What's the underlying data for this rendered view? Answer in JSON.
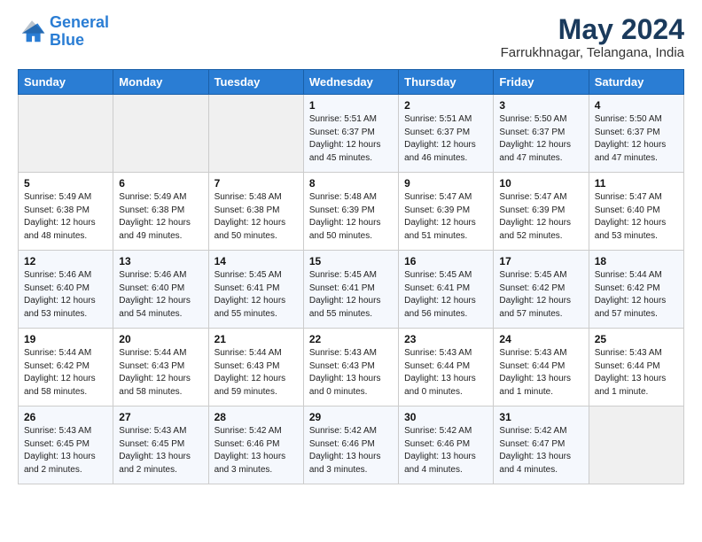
{
  "logo": {
    "line1": "General",
    "line2": "Blue"
  },
  "title": "May 2024",
  "subtitle": "Farrukhnagar, Telangana, India",
  "days_of_week": [
    "Sunday",
    "Monday",
    "Tuesday",
    "Wednesday",
    "Thursday",
    "Friday",
    "Saturday"
  ],
  "weeks": [
    [
      {
        "day": "",
        "info": ""
      },
      {
        "day": "",
        "info": ""
      },
      {
        "day": "",
        "info": ""
      },
      {
        "day": "1",
        "info": "Sunrise: 5:51 AM\nSunset: 6:37 PM\nDaylight: 12 hours\nand 45 minutes."
      },
      {
        "day": "2",
        "info": "Sunrise: 5:51 AM\nSunset: 6:37 PM\nDaylight: 12 hours\nand 46 minutes."
      },
      {
        "day": "3",
        "info": "Sunrise: 5:50 AM\nSunset: 6:37 PM\nDaylight: 12 hours\nand 47 minutes."
      },
      {
        "day": "4",
        "info": "Sunrise: 5:50 AM\nSunset: 6:37 PM\nDaylight: 12 hours\nand 47 minutes."
      }
    ],
    [
      {
        "day": "5",
        "info": "Sunrise: 5:49 AM\nSunset: 6:38 PM\nDaylight: 12 hours\nand 48 minutes."
      },
      {
        "day": "6",
        "info": "Sunrise: 5:49 AM\nSunset: 6:38 PM\nDaylight: 12 hours\nand 49 minutes."
      },
      {
        "day": "7",
        "info": "Sunrise: 5:48 AM\nSunset: 6:38 PM\nDaylight: 12 hours\nand 50 minutes."
      },
      {
        "day": "8",
        "info": "Sunrise: 5:48 AM\nSunset: 6:39 PM\nDaylight: 12 hours\nand 50 minutes."
      },
      {
        "day": "9",
        "info": "Sunrise: 5:47 AM\nSunset: 6:39 PM\nDaylight: 12 hours\nand 51 minutes."
      },
      {
        "day": "10",
        "info": "Sunrise: 5:47 AM\nSunset: 6:39 PM\nDaylight: 12 hours\nand 52 minutes."
      },
      {
        "day": "11",
        "info": "Sunrise: 5:47 AM\nSunset: 6:40 PM\nDaylight: 12 hours\nand 53 minutes."
      }
    ],
    [
      {
        "day": "12",
        "info": "Sunrise: 5:46 AM\nSunset: 6:40 PM\nDaylight: 12 hours\nand 53 minutes."
      },
      {
        "day": "13",
        "info": "Sunrise: 5:46 AM\nSunset: 6:40 PM\nDaylight: 12 hours\nand 54 minutes."
      },
      {
        "day": "14",
        "info": "Sunrise: 5:45 AM\nSunset: 6:41 PM\nDaylight: 12 hours\nand 55 minutes."
      },
      {
        "day": "15",
        "info": "Sunrise: 5:45 AM\nSunset: 6:41 PM\nDaylight: 12 hours\nand 55 minutes."
      },
      {
        "day": "16",
        "info": "Sunrise: 5:45 AM\nSunset: 6:41 PM\nDaylight: 12 hours\nand 56 minutes."
      },
      {
        "day": "17",
        "info": "Sunrise: 5:45 AM\nSunset: 6:42 PM\nDaylight: 12 hours\nand 57 minutes."
      },
      {
        "day": "18",
        "info": "Sunrise: 5:44 AM\nSunset: 6:42 PM\nDaylight: 12 hours\nand 57 minutes."
      }
    ],
    [
      {
        "day": "19",
        "info": "Sunrise: 5:44 AM\nSunset: 6:42 PM\nDaylight: 12 hours\nand 58 minutes."
      },
      {
        "day": "20",
        "info": "Sunrise: 5:44 AM\nSunset: 6:43 PM\nDaylight: 12 hours\nand 58 minutes."
      },
      {
        "day": "21",
        "info": "Sunrise: 5:44 AM\nSunset: 6:43 PM\nDaylight: 12 hours\nand 59 minutes."
      },
      {
        "day": "22",
        "info": "Sunrise: 5:43 AM\nSunset: 6:43 PM\nDaylight: 13 hours\nand 0 minutes."
      },
      {
        "day": "23",
        "info": "Sunrise: 5:43 AM\nSunset: 6:44 PM\nDaylight: 13 hours\nand 0 minutes."
      },
      {
        "day": "24",
        "info": "Sunrise: 5:43 AM\nSunset: 6:44 PM\nDaylight: 13 hours\nand 1 minute."
      },
      {
        "day": "25",
        "info": "Sunrise: 5:43 AM\nSunset: 6:44 PM\nDaylight: 13 hours\nand 1 minute."
      }
    ],
    [
      {
        "day": "26",
        "info": "Sunrise: 5:43 AM\nSunset: 6:45 PM\nDaylight: 13 hours\nand 2 minutes."
      },
      {
        "day": "27",
        "info": "Sunrise: 5:43 AM\nSunset: 6:45 PM\nDaylight: 13 hours\nand 2 minutes."
      },
      {
        "day": "28",
        "info": "Sunrise: 5:42 AM\nSunset: 6:46 PM\nDaylight: 13 hours\nand 3 minutes."
      },
      {
        "day": "29",
        "info": "Sunrise: 5:42 AM\nSunset: 6:46 PM\nDaylight: 13 hours\nand 3 minutes."
      },
      {
        "day": "30",
        "info": "Sunrise: 5:42 AM\nSunset: 6:46 PM\nDaylight: 13 hours\nand 4 minutes."
      },
      {
        "day": "31",
        "info": "Sunrise: 5:42 AM\nSunset: 6:47 PM\nDaylight: 13 hours\nand 4 minutes."
      },
      {
        "day": "",
        "info": ""
      }
    ]
  ]
}
